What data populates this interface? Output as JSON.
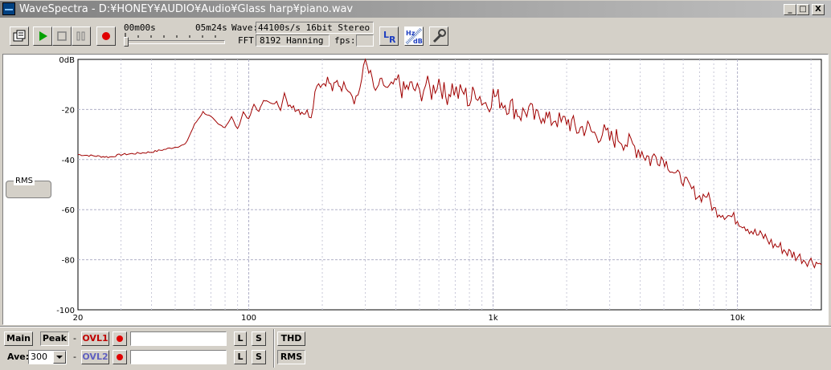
{
  "window": {
    "title": "WaveSpectra - D:¥HONEY¥AUDIO¥Audio¥Glass harp¥piano.wav",
    "minimize_label": "_",
    "maximize_label": "□",
    "close_label": "X"
  },
  "toolbar": {
    "time_start": "00m00s",
    "time_end": "05m24s",
    "position_fraction": 0.0,
    "wave_label": "Wave:",
    "wave_value": "44100s/s 16bit Stereo",
    "fft_label": "FFT:",
    "fft_value": "8192 Hanning",
    "fps_label": "fps:",
    "fps_value": "",
    "lr_icon": "LR",
    "hz_icon_top": "Hz",
    "hz_icon_bottom": "dB",
    "icons": [
      "open-file-icon",
      "play-icon",
      "stop-icon",
      "pause-icon",
      "record-icon",
      "lr-channel-icon",
      "hz-db-icon",
      "settings-wrench-icon"
    ]
  },
  "rms_label": "RMS",
  "chart_data": {
    "type": "line",
    "xscale": "log",
    "xlim": [
      20,
      22050
    ],
    "ylim": [
      -100,
      0
    ],
    "y_ticks": [
      "0dB",
      "-20",
      "-40",
      "-60",
      "-80",
      "-100"
    ],
    "x_ticks": [
      "20",
      "100",
      "1k",
      "10k"
    ],
    "grid": true,
    "line_color": "#a00000",
    "series": [
      {
        "x": [
          20,
          23,
          27,
          30,
          35,
          40,
          45,
          50,
          55,
          60,
          65,
          70,
          75,
          80,
          85,
          90,
          95,
          100,
          105,
          110,
          115,
          120,
          125,
          130,
          135,
          140,
          145,
          150,
          160,
          170,
          180,
          190,
          200,
          210,
          220,
          230,
          240,
          250,
          260,
          270,
          280,
          290,
          300,
          310,
          320,
          330,
          340,
          350,
          370,
          390,
          410,
          430,
          450,
          480,
          500,
          530,
          560,
          600,
          640,
          680,
          720,
          760,
          800,
          850,
          900,
          950,
          1000,
          1100,
          1200,
          1300,
          1400,
          1500,
          1600,
          1700,
          1800,
          1900,
          2000,
          2200,
          2400,
          2600,
          2800,
          3000,
          3300,
          3600,
          4000,
          4400,
          4800,
          5200,
          5600,
          6000,
          6500,
          7000,
          7500,
          8000,
          9000,
          10000,
          11000,
          12000,
          13000,
          14000,
          15000,
          16000,
          17000,
          18000,
          19000,
          20000,
          21000,
          22050
        ],
        "y": [
          -38,
          -38.5,
          -39,
          -38,
          -37.5,
          -37,
          -36,
          -35,
          -34,
          -26,
          -21,
          -23,
          -26,
          -27,
          -23,
          -28,
          -21,
          -24,
          -18,
          -21,
          -16,
          -17,
          -18,
          -17,
          -20,
          -13,
          -19,
          -18,
          -20,
          -21,
          -22,
          -9,
          -10,
          -8,
          -12,
          -9,
          -11,
          -10,
          -12,
          -16,
          -14,
          -8,
          0,
          -4,
          -8,
          -14,
          -10,
          -9,
          -12,
          -10,
          -9,
          -13,
          -11,
          -12,
          -14,
          -10,
          -13,
          -8,
          -15,
          -11,
          -14,
          -13,
          -17,
          -12,
          -16,
          -18,
          -14,
          -17,
          -19,
          -22,
          -20,
          -24,
          -21,
          -25,
          -23,
          -26,
          -24,
          -28,
          -27,
          -30,
          -29,
          -32,
          -31,
          -34,
          -36,
          -40,
          -38,
          -42,
          -46,
          -48,
          -52,
          -55,
          -54,
          -60,
          -62,
          -64,
          -67,
          -70,
          -71,
          -74,
          -75,
          -77,
          -78,
          -79,
          -80,
          -80.5,
          -81,
          -82
        ]
      }
    ]
  },
  "bottom": {
    "main_label": "Main",
    "peak_label": "Peak",
    "dash1": "-",
    "ovl1_label": "OVL1",
    "l1_label": "L",
    "s1_label": "S",
    "thd_label": "THD",
    "ave_label": "Ave:",
    "ave_value": "300",
    "dash2": "-",
    "ovl2_label": "OVL2",
    "l2_label": "L",
    "s2_label": "S",
    "rms_label": "RMS",
    "ovl1_color": "#c00000",
    "ovl2_color": "#6060c0"
  }
}
